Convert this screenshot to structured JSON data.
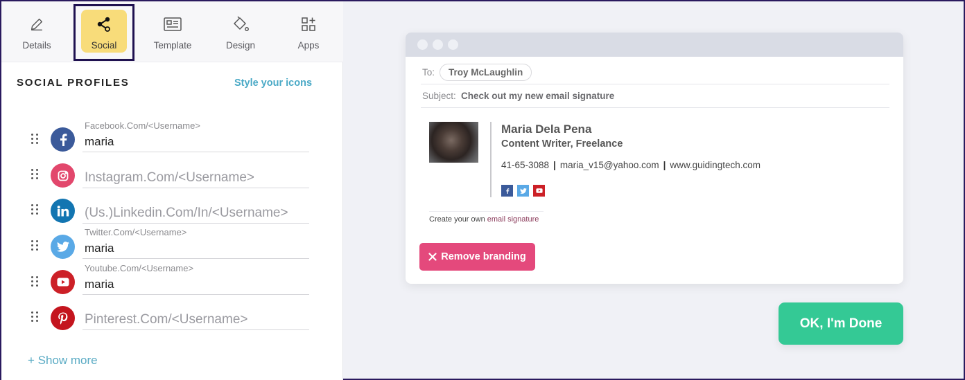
{
  "tabs": [
    {
      "label": "Details",
      "icon": "pencil-icon",
      "active": false
    },
    {
      "label": "Social",
      "icon": "share-icon",
      "active": true
    },
    {
      "label": "Template",
      "icon": "template-icon",
      "active": false
    },
    {
      "label": "Design",
      "icon": "paint-bucket-icon",
      "active": false
    },
    {
      "label": "Apps",
      "icon": "apps-add-icon",
      "active": false
    }
  ],
  "social_section": {
    "title": "SOCIAL PROFILES",
    "style_link": "Style your icons",
    "profiles": [
      {
        "network": "facebook",
        "label": "Facebook.Com/<Username>",
        "value": "maria",
        "placeholder": "",
        "color": "#3b5a9a"
      },
      {
        "network": "instagram",
        "label": "",
        "value": "",
        "placeholder": "Instagram.Com/<Username>",
        "color": "#e2476c"
      },
      {
        "network": "linkedin",
        "label": "",
        "value": "",
        "placeholder": "(Us.)Linkedin.Com/In/<Username>",
        "color": "#1275b1"
      },
      {
        "network": "twitter",
        "label": "Twitter.Com/<Username>",
        "value": "maria",
        "placeholder": "",
        "color": "#5aa9e6"
      },
      {
        "network": "youtube",
        "label": "Youtube.Com/<Username>",
        "value": "maria",
        "placeholder": "",
        "color": "#cc2027"
      },
      {
        "network": "pinterest",
        "label": "",
        "value": "",
        "placeholder": "Pinterest.Com/<Username>",
        "color": "#c4151e"
      }
    ],
    "show_more": "+ Show more"
  },
  "email_preview": {
    "to_label": "To:",
    "to_value": "Troy McLaughlin",
    "subject_label": "Subject:",
    "subject_value": "Check out my new email signature",
    "signature": {
      "name": "Maria Dela Pena",
      "title": "Content Writer, Freelance",
      "phone": "41-65-3088",
      "email": "maria_v15@yahoo.com",
      "website": "www.guidingtech.com",
      "separator": "|",
      "social_icons": [
        "facebook",
        "twitter",
        "youtube"
      ],
      "social_colors": {
        "facebook": "#3b5a9a",
        "twitter": "#5aa9e6",
        "youtube": "#cc2027"
      }
    },
    "branding_prefix": "Create your own ",
    "branding_link": "email signature",
    "remove_branding": "Remove branding"
  },
  "done_button": "OK, I'm Done",
  "colors": {
    "active_tab": "#f8dc7a",
    "link": "#4aa9c6",
    "remove_branding": "#e4497c",
    "done": "#34c995"
  }
}
